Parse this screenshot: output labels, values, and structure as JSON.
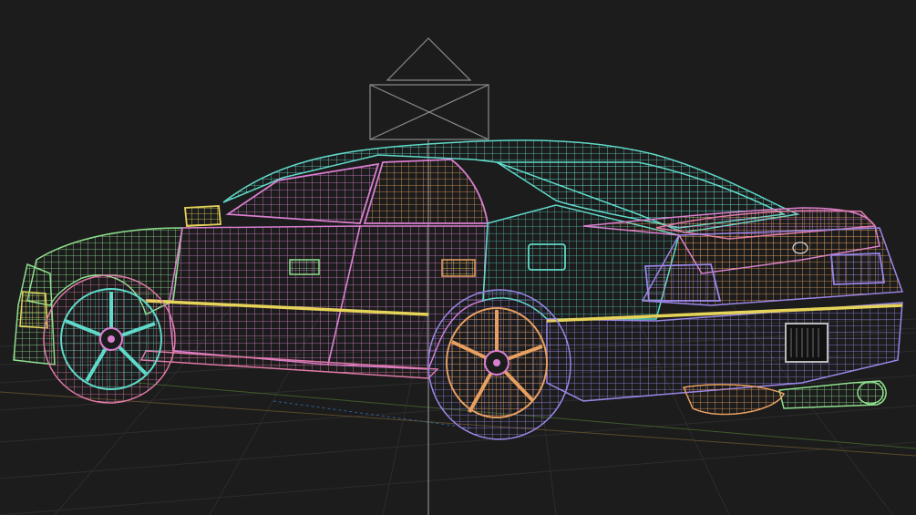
{
  "scene": {
    "subject": "wireframe-sedan",
    "colors": {
      "background": "#1c1c1c",
      "grid": "#2e2e2e",
      "grid_major": "#3a3a3a",
      "axis_red": "#7a3a2a",
      "axis_green": "#3f6a2a",
      "axis_blue": "#2f5f8f",
      "camera": "#8a8a8a",
      "cyan": "#5fd9c9",
      "magenta": "#d97fd0",
      "pink": "#e07aa8",
      "orange": "#e8a060",
      "yellow": "#e6d35a",
      "green": "#8fe08f",
      "violet": "#9a86e8",
      "teal": "#4fbfb0",
      "lime": "#c8e070"
    }
  }
}
